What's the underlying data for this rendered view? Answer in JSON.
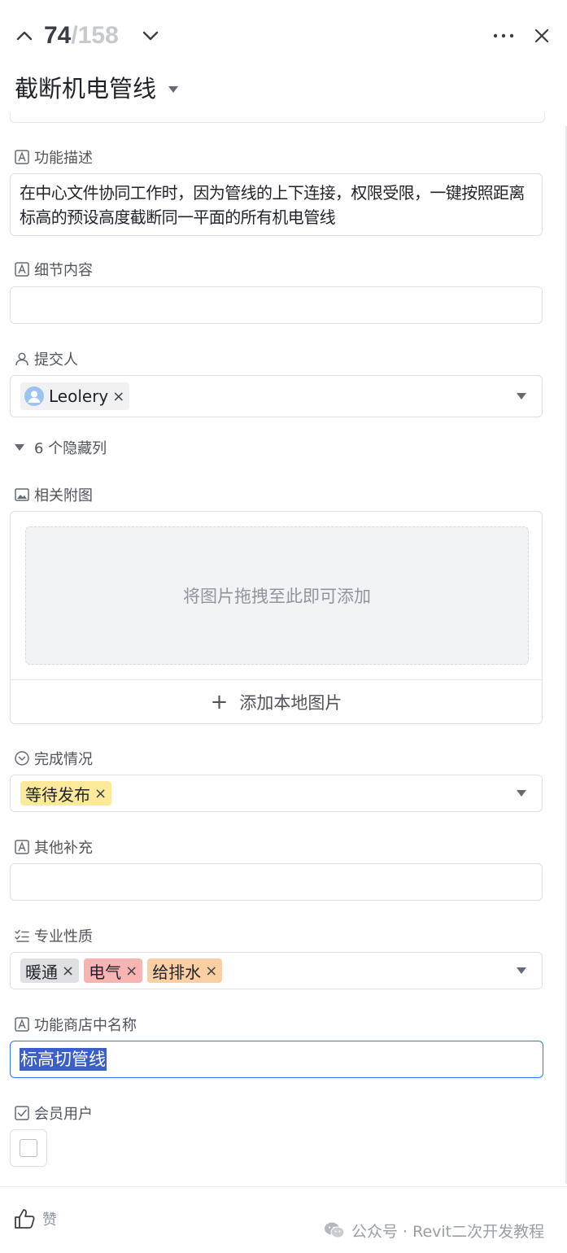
{
  "header": {
    "current_index": "74",
    "total": "/158"
  },
  "record": {
    "title": "截断机电管线"
  },
  "fields": {
    "description": {
      "label": "功能描述",
      "value": "在中心文件协同工作时，因为管线的上下连接，权限受限，一键按照距离标高的预设高度截断同一平面的所有机电管线"
    },
    "details": {
      "label": "细节内容",
      "value": ""
    },
    "submitter": {
      "label": "提交人",
      "user": "Leolery"
    },
    "hidden_columns": {
      "label": "6 个隐藏列"
    },
    "attachments": {
      "label": "相关附图",
      "drop_hint": "将图片拖拽至此即可添加",
      "add_local": "添加本地图片"
    },
    "status": {
      "label": "完成情况",
      "value": "等待发布",
      "color": "#fde99a"
    },
    "other": {
      "label": "其他补充",
      "value": ""
    },
    "discipline": {
      "label": "专业性质",
      "tags": [
        {
          "text": "暖通",
          "color": "#dee0e3"
        },
        {
          "text": "电气",
          "color": "#f8b3b3"
        },
        {
          "text": "给排水",
          "color": "#fbcfa4"
        }
      ]
    },
    "store_name": {
      "label": "功能商店中名称",
      "value": "标高切管线"
    },
    "member": {
      "label": "会员用户",
      "checked": false
    }
  },
  "footer": {
    "like_label": "赞",
    "watermark": "公众号 · Revit二次开发教程"
  },
  "colors": {
    "accent": "#3370ff",
    "selection": "#3a5fc7",
    "border": "#dee0e3",
    "muted_text": "#8f959e"
  }
}
